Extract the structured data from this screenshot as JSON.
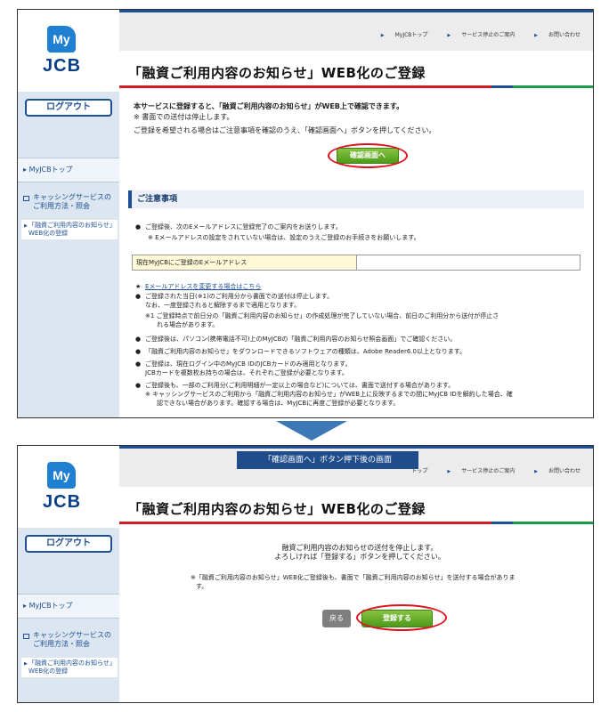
{
  "sidebar": {
    "logo_my": "My",
    "logo_jcb": "JCB",
    "logout": "ログアウト",
    "myjcb_top": "MyJCBトップ",
    "cashing_line1": "キャッシングサービスの",
    "cashing_line2": "ご利用方法・照会",
    "current_line1": "「融資ご利用内容のお知らせ」",
    "current_line2": "WEB化の登録"
  },
  "topnav": {
    "items": [
      "MyJCBトップ",
      "サービス停止のご案内",
      "お問い合わせ"
    ],
    "item_partial": "トップ"
  },
  "page_title": "「融資ご利用内容のお知らせ」WEB化のご登録",
  "screen1": {
    "intro_bold": "本サービスに登録すると、「融資ご利用内容のお知らせ」がWEB上で確認できます。",
    "intro_note": "※ 書面での送付は停止します。",
    "intro_instruction": "ご登録を希望される場合はご注意事項を確認のうえ、「確認画面へ」ボタンを押してください。",
    "confirm_button": "確認画面へ",
    "notes_heading": "ご注意事項",
    "note1": "ご登録後、次のEメールアドレスに登録完了のご案内をお送りします。",
    "note1_sub": "※ Eメールアドレスの設定をされていない場合は、設定のうえご登録のお手続きをお願いします。",
    "email_label": "現在MyJCBにご登録のEメールアドレス",
    "change_email_link": "Eメールアドレスを変更する場合はこちら",
    "note2": "ご登録された当日(※1)のご利用分から書面での送付は停止します。",
    "note2_b": "なお、一度登録されると解除するまで適用となります。",
    "note2_c": "※1 ご登録時点で前日分の「融資ご利用内容のお知らせ」の作成処理が完了していない場合、前日のご利用分から送付が停止さ",
    "note2_d": "れる場合があります。",
    "note3": "ご登録後は、パソコン(携帯電話不可)上のMyJCBの「融資ご利用内容のお知らせ照会画面」でご確認ください。",
    "note4": "「融資ご利用内容のお知らせ」をダウンロードできるソフトウェアの種類は、Adobe Reader6.0以上となります。",
    "note5": "ご登録は、現在ログイン中のMyJCB IDのJCBカードのみ適用となります。",
    "note5_b": "JCBカードを複数枚お持ちの場合は、それぞれご登録が必要となります。",
    "note6": "ご登録後も、一部のご利用分(ご利用明細が一定以上の場合など)については、書面で送付する場合があります。",
    "note6_b": "※ キャッシングサービスのご利用から「融資ご利用内容のお知らせ」がWEB上に反映するまでの間にMyJCB IDを解約した場合、確",
    "note6_c": "認できない場合があります。確認する場合は、MyJCBに再度ご登録が必要となります。"
  },
  "screen2": {
    "overlay_label": "「確認画面へ」ボタン押下後の画面",
    "line1": "融資ご利用内容のお知らせの送付を停止します。",
    "line2": "よろしければ「登録する」ボタンを押してください。",
    "note_a": "※「融資ご利用内容のお知らせ」WEB化ご登録後も、書面で「融資ご利用内容のお知らせ」を送付する場合がありま",
    "note_b": "す。",
    "back_button": "戻る",
    "register_button": "登録する"
  },
  "colors": {
    "accent_blue": "#1d4f95",
    "highlight_red": "#e0101b",
    "button_green": "#5aa525",
    "sidebar_bg": "#dbe6f1"
  }
}
